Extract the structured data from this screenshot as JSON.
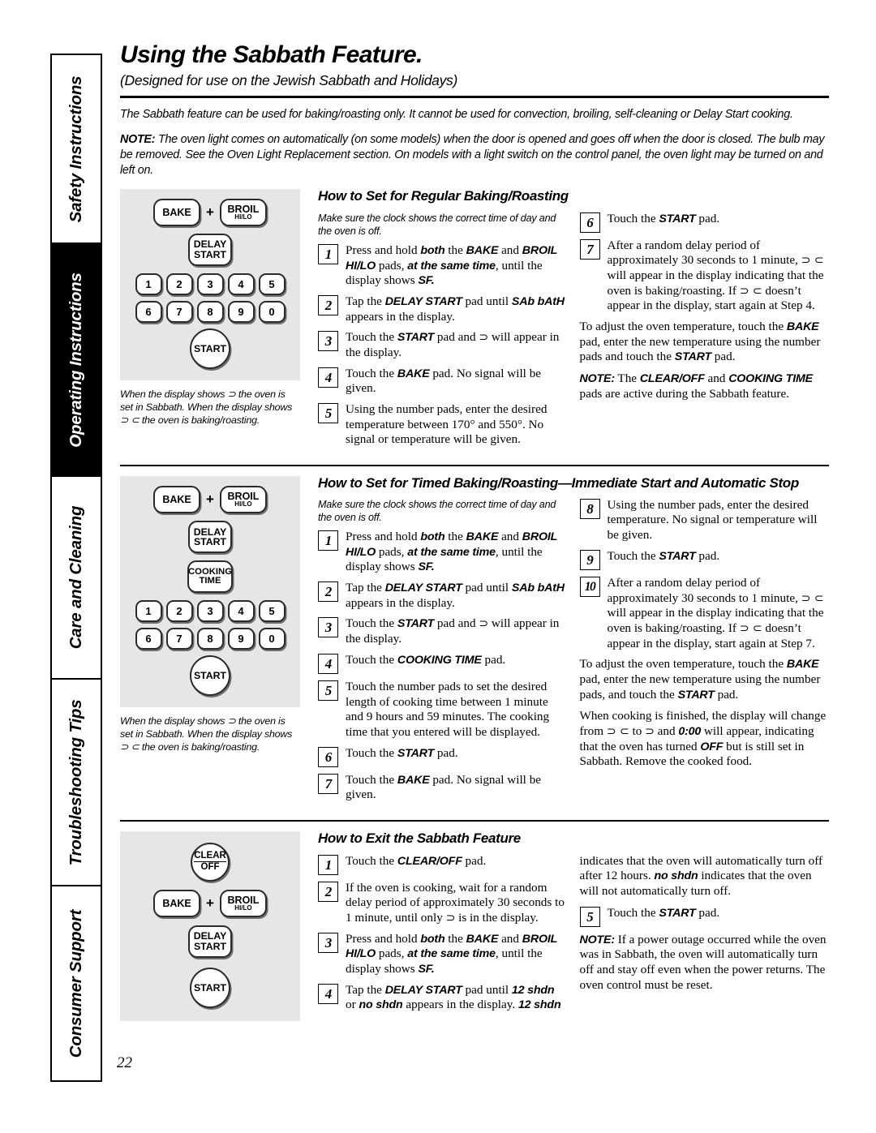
{
  "sidebar": {
    "tabs": [
      {
        "label": "Safety Instructions",
        "active": false
      },
      {
        "label": "Operating Instructions",
        "active": true
      },
      {
        "label": "Care and Cleaning",
        "active": false
      },
      {
        "label": "Troubleshooting Tips",
        "active": false
      },
      {
        "label": "Consumer Support",
        "active": false
      }
    ]
  },
  "header": {
    "title": "Using the Sabbath Feature.",
    "subtitle": "(Designed for use on the Jewish Sabbath and Holidays)"
  },
  "intro": {
    "paragraph1": "The Sabbath feature can be used for baking/roasting only. It cannot be used for convection, broiling, self-cleaning or Delay Start cooking.",
    "note_label": "NOTE:",
    "note_text": " The oven light comes on automatically (on some models) when the door is opened and goes off when the door is closed. The bulb may be removed. See the Oven Light Replacement section. On models with a light switch on the control panel, the oven light may be turned on and left on."
  },
  "pads": {
    "bake": "BAKE",
    "broil": "BROIL",
    "broil_sub": "HI/LO",
    "delay_line1": "DELAY",
    "delay_line2": "START",
    "cooking_line1": "COOKING",
    "cooking_line2": "TIME",
    "start": "START",
    "clear_line1": "CLEAR",
    "clear_line2": "OFF",
    "plus": "+",
    "numbers": [
      "1",
      "2",
      "3",
      "4",
      "5",
      "6",
      "7",
      "8",
      "9",
      "0"
    ]
  },
  "diagram_caption": "When the display shows ⊃ the oven is set in Sabbath. When the display shows ⊃ ⊂ the oven is baking/roasting.",
  "sections": [
    {
      "heading": "How to Set for Regular Baking/Roasting",
      "lead": "Make sure the clock shows the correct time of day and the oven is off.",
      "steps_left": [
        {
          "num": "1",
          "html": "Press and hold <b>both</b> the <b>BAKE</b> and <b>BROIL HI/LO</b> pads, <b>at the same time</b>, until the display shows <b>SF.</b>"
        },
        {
          "num": "2",
          "html": "Tap the <b>DELAY START</b> pad until <b>SAb bAtH</b> appears in the display."
        },
        {
          "num": "3",
          "html": "Touch the <b>START</b> pad and <span class=\"sym\">⊃</span> will appear in the display."
        },
        {
          "num": "4",
          "html": "Touch the <b>BAKE</b> pad. No signal will be given."
        },
        {
          "num": "5",
          "html": "Using the number pads, enter the desired temperature between 170° and 550°. No signal or temperature will be given."
        }
      ],
      "steps_right": [
        {
          "num": "6",
          "html": "Touch the <b>START</b> pad."
        },
        {
          "num": "7",
          "html": "After a random delay period of approximately 30 seconds to 1 minute, <span class=\"sym\">⊃ ⊂</span> will appear in the display indicating that the oven is baking/roasting. If <span class=\"sym\">⊃ ⊂</span> doesn’t appear in the display, start again at Step 4."
        }
      ],
      "paras_right": [
        "To adjust the oven temperature, touch the <b>BAKE</b> pad, enter the new temperature using the number pads and touch the <b>START</b> pad.",
        "<b>NOTE:</b> The <b>CLEAR/OFF</b> and <b>COOKING TIME</b> pads are active during the Sabbath feature."
      ]
    },
    {
      "heading": "How to Set for Timed Baking/Roasting—Immediate Start and Automatic Stop",
      "lead": "Make sure the clock shows the correct time of day and the oven is off.",
      "steps_left": [
        {
          "num": "1",
          "html": "Press and hold <b>both</b> the <b>BAKE</b> and <b>BROIL HI/LO</b> pads, <b>at the same time</b>, until the display shows <b>SF.</b>"
        },
        {
          "num": "2",
          "html": "Tap the <b>DELAY START</b> pad until <b>SAb bAtH</b> appears in the display."
        },
        {
          "num": "3",
          "html": "Touch the <b>START</b> pad and <span class=\"sym\">⊃</span> will appear in the display."
        },
        {
          "num": "4",
          "html": "Touch the <b>COOKING TIME</b> pad."
        },
        {
          "num": "5",
          "html": "Touch the number pads to set the desired length of cooking time between 1 minute and 9 hours and 59 minutes. The cooking time that you entered will be displayed."
        },
        {
          "num": "6",
          "html": "Touch the <b>START</b> pad."
        },
        {
          "num": "7",
          "html": "Touch the <b>BAKE</b> pad. No signal will be given."
        }
      ],
      "steps_right": [
        {
          "num": "8",
          "html": "Using the number pads, enter the desired temperature. No signal or temperature will be given."
        },
        {
          "num": "9",
          "html": "Touch the <b>START</b> pad."
        },
        {
          "num": "10",
          "html": "After a random delay period of approximately 30 seconds to 1 minute, <span class=\"sym\">⊃ ⊂</span> will appear in the display indicating that the oven is baking/roasting. If <span class=\"sym\">⊃ ⊂</span> doesn’t appear in the display, start again at Step 7."
        }
      ],
      "paras_right": [
        "To adjust the oven temperature, touch the <b>BAKE</b> pad, enter the new temperature using the number pads, and touch the <b>START</b> pad.",
        "When cooking is finished, the display will change from <span class=\"sym\">⊃ ⊂</span> to <span class=\"sym\">⊃</span> and <b>0:00</b> will appear, indicating that the oven has turned <b>OFF</b> but is still set in Sabbath. Remove the cooked food."
      ]
    },
    {
      "heading": "How to Exit the Sabbath Feature",
      "lead": "",
      "steps_left": [
        {
          "num": "1",
          "html": "Touch the <b>CLEAR/OFF</b> pad."
        },
        {
          "num": "2",
          "html": "If the oven is cooking, wait for a random delay period of approximately 30 seconds to 1 minute, until only <span class=\"sym\">⊃</span> is in the display."
        },
        {
          "num": "3",
          "html": "Press and hold <b>both</b> the <b>BAKE</b> and <b>BROIL HI/LO</b> pads, <b>at the same time</b>, until the display shows <b>SF.</b>"
        },
        {
          "num": "4",
          "html": "Tap the <b>DELAY START</b> pad until <b>12 shdn</b> or <b>no shdn</b> appears in the display. <b>12 shdn</b>"
        }
      ],
      "steps_right": [
        {
          "num": "5",
          "html": "Touch the <b>START</b> pad."
        }
      ],
      "paras_right_top": [
        "indicates that the oven will automatically turn off after 12 hours. <b>no shdn</b> indicates that the oven will not automatically turn off."
      ],
      "paras_right": [
        "<b>NOTE:</b> If a power outage occurred while the oven was in Sabbath, the oven will automatically turn off and stay off even when the power returns. The oven control must be reset."
      ]
    }
  ],
  "page_number": "22"
}
